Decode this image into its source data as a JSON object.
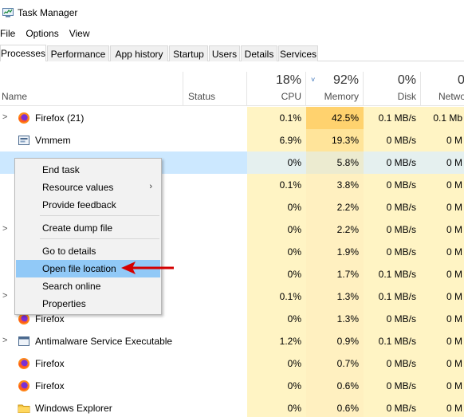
{
  "window": {
    "title": "Task Manager",
    "icon": "task-manager-icon"
  },
  "menubar": {
    "items": [
      "File",
      "Options",
      "View"
    ]
  },
  "tabs": [
    {
      "label": "Processes",
      "active": true
    },
    {
      "label": "Performance",
      "active": false
    },
    {
      "label": "App history",
      "active": false
    },
    {
      "label": "Startup",
      "active": false
    },
    {
      "label": "Users",
      "active": false
    },
    {
      "label": "Details",
      "active": false
    },
    {
      "label": "Services",
      "active": false
    }
  ],
  "columns": {
    "name": "Name",
    "status": "Status",
    "cpu": {
      "pct": "18%",
      "label": "CPU"
    },
    "memory": {
      "pct": "92%",
      "label": "Memory",
      "sort_indicator": "˅"
    },
    "disk": {
      "pct": "0%",
      "label": "Disk"
    },
    "network": {
      "pct": "0",
      "label": "Netwo"
    }
  },
  "rows": [
    {
      "expander": ">",
      "icon": "firefox-icon",
      "name": "Firefox (21)",
      "status": "",
      "cpu": "0.1%",
      "memory": "42.5%",
      "disk": "0.1 MB/s",
      "network": "0.1 Mb"
    },
    {
      "expander": "",
      "icon": "vmmem-icon",
      "name": "Vmmem",
      "status": "",
      "cpu": "6.9%",
      "memory": "19.3%",
      "disk": "0 MB/s",
      "network": "0 M"
    },
    {
      "expander": "",
      "icon": "",
      "name": "",
      "status": "",
      "cpu": "0%",
      "memory": "5.8%",
      "disk": "0 MB/s",
      "network": "0 M",
      "selected": true
    },
    {
      "expander": "",
      "icon": "",
      "name": "",
      "status": "",
      "cpu": "0.1%",
      "memory": "3.8%",
      "disk": "0 MB/s",
      "network": "0 M"
    },
    {
      "expander": "",
      "icon": "",
      "name": "",
      "status": "",
      "cpu": "0%",
      "memory": "2.2%",
      "disk": "0 MB/s",
      "network": "0 M"
    },
    {
      "expander": ">",
      "icon": "",
      "name": "",
      "status": "",
      "cpu": "0%",
      "memory": "2.2%",
      "disk": "0 MB/s",
      "network": "0 M"
    },
    {
      "expander": "",
      "icon": "",
      "name": "",
      "status": "",
      "cpu": "0%",
      "memory": "1.9%",
      "disk": "0 MB/s",
      "network": "0 M"
    },
    {
      "expander": "",
      "icon": "",
      "name": "",
      "status": "",
      "cpu": "0%",
      "memory": "1.7%",
      "disk": "0.1 MB/s",
      "network": "0 M"
    },
    {
      "expander": ">",
      "icon": "",
      "name": "",
      "status": "",
      "cpu": "0.1%",
      "memory": "1.3%",
      "disk": "0.1 MB/s",
      "network": "0 M"
    },
    {
      "expander": "",
      "icon": "firefox-icon",
      "name": "Firefox",
      "status": "",
      "cpu": "0%",
      "memory": "1.3%",
      "disk": "0 MB/s",
      "network": "0 M"
    },
    {
      "expander": ">",
      "icon": "antimalware-icon",
      "name": "Antimalware Service Executable",
      "status": "",
      "cpu": "1.2%",
      "memory": "0.9%",
      "disk": "0.1 MB/s",
      "network": "0 M"
    },
    {
      "expander": "",
      "icon": "firefox-icon",
      "name": "Firefox",
      "status": "",
      "cpu": "0%",
      "memory": "0.7%",
      "disk": "0 MB/s",
      "network": "0 M"
    },
    {
      "expander": "",
      "icon": "firefox-icon",
      "name": "Firefox",
      "status": "",
      "cpu": "0%",
      "memory": "0.6%",
      "disk": "0 MB/s",
      "network": "0 M"
    },
    {
      "expander": "",
      "icon": "explorer-icon",
      "name": "Windows Explorer",
      "status": "",
      "cpu": "0%",
      "memory": "0.6%",
      "disk": "0 MB/s",
      "network": "0 M"
    }
  ],
  "context_menu": {
    "items": [
      {
        "label": "End task"
      },
      {
        "label": "Resource values",
        "submenu": true
      },
      {
        "label": "Provide feedback"
      },
      {
        "label": "Create dump file"
      },
      {
        "label": "Go to details"
      },
      {
        "label": "Open file location",
        "highlighted": true
      },
      {
        "label": "Search online"
      },
      {
        "label": "Properties"
      }
    ]
  },
  "colors": {
    "cpu_bg": "#fff4c4",
    "mem_bg_default": "#fff0c0",
    "mem_bg_high": "#ffd26e",
    "mem_bg_mid": "#ffe49a",
    "selected_row": "#cce8ff",
    "menu_highlight": "#91c9f7",
    "annotation_arrow": "#d40000"
  }
}
